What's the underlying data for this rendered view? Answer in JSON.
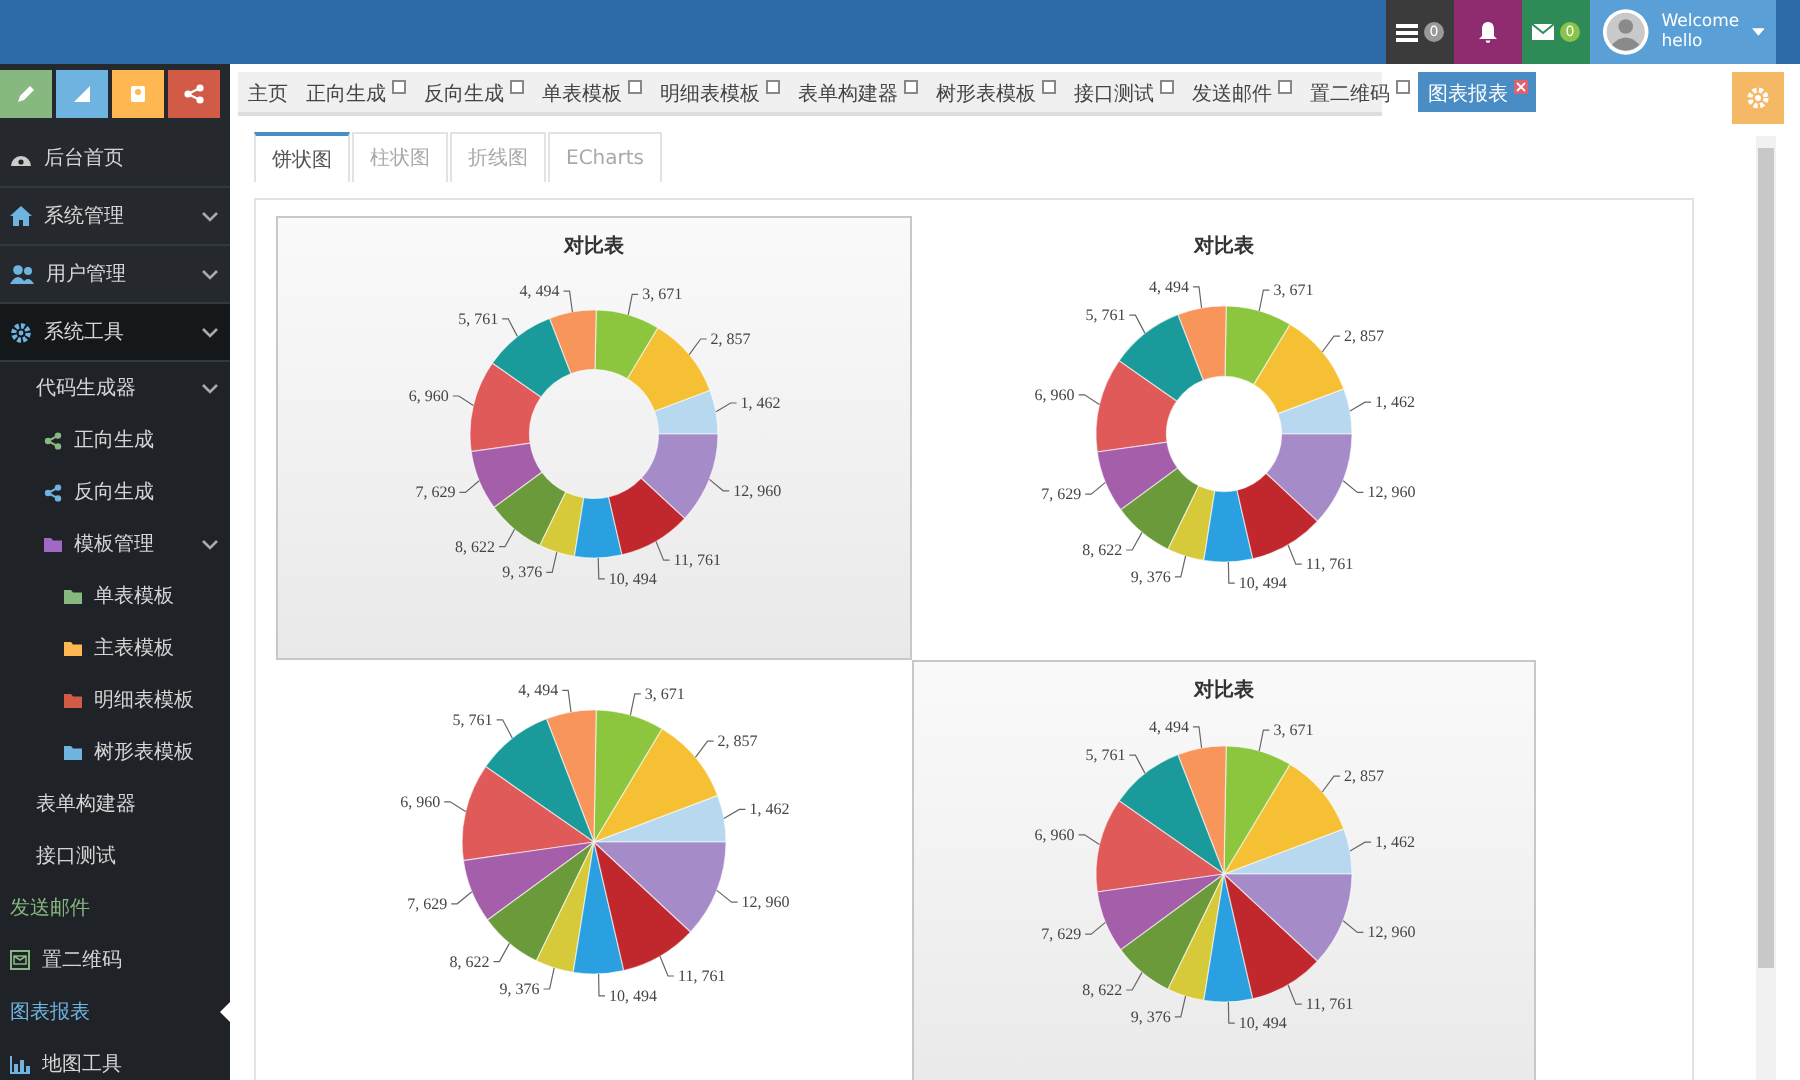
{
  "top_bar": {
    "notifications": [
      {
        "kind": "tasks",
        "badge": "0"
      },
      {
        "kind": "alerts"
      },
      {
        "kind": "messages",
        "badge": "0"
      }
    ],
    "user": {
      "greeting": "Welcome",
      "name": "hello"
    }
  },
  "sidebar": {
    "items": [
      {
        "label": "后台首页",
        "selected": false
      },
      {
        "label": "系统管理",
        "selected": false,
        "expanded": false
      },
      {
        "label": "用户管理",
        "selected": false,
        "expanded": false
      },
      {
        "label": "系统工具",
        "selected": false,
        "expanded": true,
        "children": [
          {
            "label": "代码生成器",
            "selected": false,
            "expanded": true,
            "children": [
              {
                "label": "正向生成",
                "selected": false
              },
              {
                "label": "反向生成",
                "selected": false
              },
              {
                "label": "模板管理",
                "selected": false,
                "expanded": true,
                "children": [
                  {
                    "label": "单表模板",
                    "selected": false
                  },
                  {
                    "label": "主表模板",
                    "selected": false
                  },
                  {
                    "label": "明细表模板",
                    "selected": false
                  },
                  {
                    "label": "树形表模板",
                    "selected": false
                  }
                ]
              }
            ]
          },
          {
            "label": "表单构建器",
            "selected": false
          },
          {
            "label": "接口测试",
            "selected": false
          }
        ]
      },
      {
        "label": "发送邮件",
        "selected": false,
        "hovered": true
      },
      {
        "label": "置二维码",
        "selected": false
      },
      {
        "label": "图表报表",
        "selected": true
      },
      {
        "label": "地图工具",
        "selected": false
      }
    ]
  },
  "tabs": [
    {
      "label": "主页",
      "selected": false,
      "closable": false
    },
    {
      "label": "正向生成",
      "selected": false,
      "closable": true
    },
    {
      "label": "反向生成",
      "selected": false,
      "closable": true
    },
    {
      "label": "单表模板",
      "selected": false,
      "closable": true
    },
    {
      "label": "明细表模板",
      "selected": false,
      "closable": true
    },
    {
      "label": "表单构建器",
      "selected": false,
      "closable": true
    },
    {
      "label": "树形表模板",
      "selected": false,
      "closable": true
    },
    {
      "label": "接口测试",
      "selected": false,
      "closable": true
    },
    {
      "label": "发送邮件",
      "selected": false,
      "closable": true
    },
    {
      "label": "置二维码",
      "selected": false,
      "closable": true
    },
    {
      "label": "图表报表",
      "selected": true,
      "closable": true
    }
  ],
  "chart_tabs": [
    {
      "label": "饼状图",
      "selected": true
    },
    {
      "label": "柱状图",
      "selected": false
    },
    {
      "label": "折线图",
      "selected": false
    },
    {
      "label": "ECharts",
      "selected": false
    }
  ],
  "charts": [
    {
      "highlighted": true,
      "chart_data": {
        "type": "donut",
        "title": "对比表",
        "values": [
          462,
          857,
          671,
          494,
          761,
          960,
          629,
          622,
          376,
          494,
          761,
          960
        ],
        "value_labels": [
          "1, 462",
          "2, 857",
          "3, 671",
          "4, 494",
          "5, 761",
          "6, 960",
          "7, 629",
          "8, 622",
          "9, 376",
          "10, 494",
          "11, 761",
          "12, 960"
        ]
      }
    },
    {
      "highlighted": false,
      "chart_data": {
        "type": "donut",
        "title": "对比表",
        "values": [
          462,
          857,
          671,
          494,
          761,
          960,
          629,
          622,
          376,
          494,
          761,
          960
        ],
        "value_labels": [
          "1, 462",
          "2, 857",
          "3, 671",
          "4, 494",
          "5, 761",
          "6, 960",
          "7, 629",
          "8, 622",
          "9, 376",
          "10, 494",
          "11, 761",
          "12, 960"
        ]
      }
    },
    {
      "highlighted": false,
      "chart_data": {
        "type": "pie",
        "values": [
          462,
          857,
          671,
          494,
          761,
          960,
          629,
          622,
          376,
          494,
          761,
          960
        ],
        "value_labels": [
          "1, 462",
          "2, 857",
          "3, 671",
          "4, 494",
          "5, 761",
          "6, 960",
          "7, 629",
          "8, 622",
          "9, 376",
          "10, 494",
          "11, 761",
          "12, 960"
        ]
      }
    },
    {
      "highlighted": true,
      "chart_data": {
        "type": "pie",
        "title": "对比表",
        "values": [
          462,
          857,
          671,
          494,
          761,
          960,
          629,
          622,
          376,
          494,
          761,
          960
        ],
        "value_labels": [
          "1, 462",
          "2, 857",
          "3, 671",
          "4, 494",
          "5, 761",
          "6, 960",
          "7, 629",
          "8, 622",
          "9, 376",
          "10, 494",
          "11, 761",
          "12, 960"
        ]
      }
    }
  ]
}
